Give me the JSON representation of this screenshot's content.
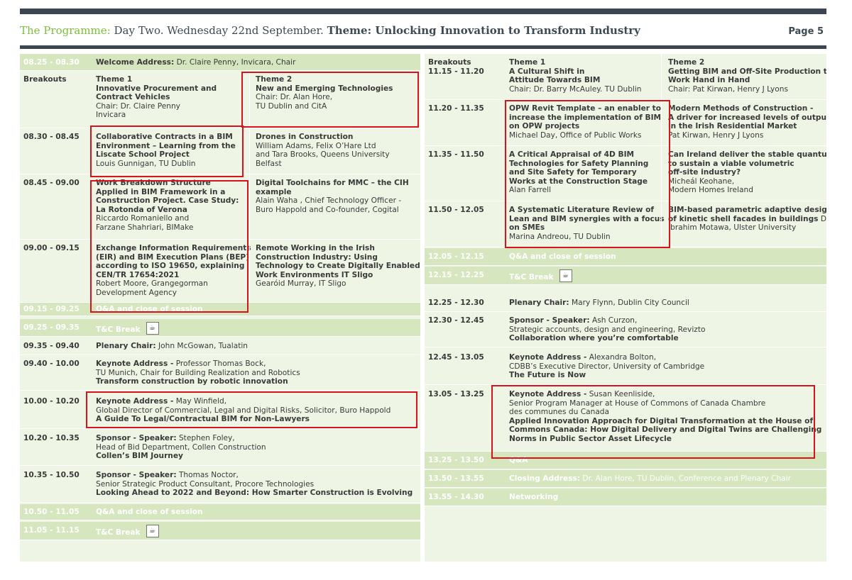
{
  "header": {
    "programme": "The Programme:",
    "day": "Day Two. Wednesday 22nd September.",
    "theme": "Theme: Unlocking Innovation to Transform Industry",
    "page": "Page 5"
  },
  "left": {
    "r1": {
      "time": "08.25 - 08.30",
      "label": "Welcome Address:",
      "text": " Dr. Claire Penny, Invicara, Chair"
    },
    "r2": {
      "time": "Breakouts",
      "a": [
        "Theme 1",
        "Innovative Procurement and",
        "Contract Vehicles",
        "Chair: Dr. Claire Penny",
        "Invicara"
      ],
      "b": [
        "Theme 2",
        "New and Emerging Technologies",
        "Chair: Dr. Alan Hore,",
        "TU Dublin and CitA"
      ]
    },
    "r3": {
      "time": "08.30 - 08.45",
      "a": [
        "Collaborative Contracts in a BIM",
        "Environment – Learning from the",
        "Liscate School Project",
        "Louis Gunnigan, TU Dublin"
      ],
      "b": [
        "Drones in Construction",
        "William Adams, Felix O’Hare Ltd",
        "and Tara Brooks, Queens University",
        "Belfast"
      ]
    },
    "r4": {
      "time": "08.45 - 09.00",
      "a": [
        "Work Breakdown Structure",
        "Applied in BIM Framework in a",
        "Construction Project. Case Study:",
        "La Rotonda of Verona",
        "Riccardo Romaniello and",
        "Farzane Shahriari, BIMake"
      ],
      "b": [
        "Digital Toolchains for MMC – the CIH",
        "example",
        "Alain Waha , Chief Technology Officer -",
        "Buro Happold and Co-founder, Cogital"
      ]
    },
    "r5": {
      "time": "09.00 - 09.15",
      "a": [
        "Exchange Information Requirements",
        "(EIR) and BIM Execution Plans (BEP)",
        "according to ISO 19650, explaining",
        "CEN/TR 17654:2021",
        "Robert Moore, Grangegorman",
        "Development Agency"
      ],
      "b": [
        "Remote Working in the Irish",
        "Construction Industry: Using",
        "Technology to Create Digitally Enabled",
        "Work Environments IT Sligo",
        "Gearóid Murray, IT Sligo"
      ]
    },
    "r6": {
      "time": "09.15 - 09.25",
      "text": "Q&A and close of session"
    },
    "r7": {
      "time": "09.25 - 09.35",
      "text": "T&C Break"
    },
    "r8": {
      "time": "09.35 - 09.40",
      "label": "Plenary Chair:",
      "text": " John McGowan, Tualatin"
    },
    "r9": {
      "time": "09.40 - 10.00",
      "label": "Keynote Address -",
      "text": " Professor Thomas Bock,",
      "l2": "TU Munich, Chair for Building Realization and Robotics",
      "l3": "Transform construction by robotic innovation"
    },
    "r10": {
      "time": "10.00 - 10.20",
      "label": "Keynote Address -",
      "text": " May Winfield,",
      "l2": "Global Director of Commercial, Legal and Digital Risks, Solicitor,  Buro Happold",
      "l3": "A Guide To Legal/Contractual BIM for Non-Lawyers"
    },
    "r11": {
      "time": "10.20 - 10.35",
      "label": "Sponsor - Speaker:",
      "text": " Stephen Foley,",
      "l2": "Head of Bid Department, Collen Construction",
      "l3": "Collen’s BIM Journey"
    },
    "r12": {
      "time": "10.35 - 10.50",
      "label": "Sponsor - Speaker:",
      "text": " Thomas Noctor,",
      "l2": "Senior Strategic Product Consultant,  Procore Technologies",
      "l3": "Looking Ahead to 2022 and Beyond: How Smarter Construction is Evolving"
    },
    "r13": {
      "time": "10.50 - 11.05",
      "text": "Q&A and close of session"
    },
    "r14": {
      "time": "11.05 - 11.15",
      "text": "T&C Break"
    }
  },
  "right": {
    "r1": {
      "time": "Breakouts",
      "time2": "11.15 - 11.20",
      "a": [
        "Theme 1",
        "A Cultural Shift in",
        "Attitude Towards BIM",
        "Chair: Dr. Barry McAuley. TU Dublin"
      ],
      "b": [
        "Theme 2",
        "Getting BIM and Off-Site Production to",
        "Work Hand in Hand",
        "Chair: Pat Kirwan, Henry J Lyons"
      ]
    },
    "r2": {
      "time": "11.20 - 11.35",
      "a": [
        "OPW Revit Template – an enabler to",
        "increase the implementation of BIM",
        "on OPW projects",
        "Michael Day, Office of Public Works"
      ],
      "b": [
        "Modern Methods of Construction -",
        "A driver for increased levels of output",
        "in the Irish Residential Market",
        "Pat Kirwan, Henry J Lyons"
      ]
    },
    "r3": {
      "time": "11.35 - 11.50",
      "a": [
        "A Critical Appraisal of 4D BIM",
        "Technologies for Safety Planning",
        "and Site Safety for Temporary",
        "Works at the Construction Stage",
        "Alan Farrell"
      ],
      "b": [
        "Can Ireland deliver the stable quantum",
        "to sustain a viable volumetric",
        "off-site industry?",
        "Micheál Keohane,",
        "Modern Homes Ireland"
      ]
    },
    "r4": {
      "time": "11.50 - 12.05",
      "a": [
        "A Systematic Literature Review of",
        "Lean and BIM synergies with a focus",
        "on SMEs",
        "Marina Andreou, TU Dublin"
      ],
      "b": [
        "BIM-based parametric adaptive design",
        "of kinetic shell facades in buildings",
        "Dr.",
        "Ibrahim Motawa, Ulster University"
      ]
    },
    "r5": {
      "time": "12.05 - 12.15",
      "text": "Q&A and close of session"
    },
    "r6": {
      "time": "12.15 - 12.25",
      "text": "T&C Break"
    },
    "r7": {
      "time": "12.25 - 12.30",
      "label": "Plenary Chair:",
      "text": " Mary Flynn, Dublin City Council"
    },
    "r8": {
      "time": "12.30 - 12.45",
      "label": "Sponsor - Speaker:",
      "text": " Ash Curzon,",
      "l2": "Strategic accounts, design and engineering, Revizto",
      "l3": "Collaboration where you’re comfortable"
    },
    "r9": {
      "time": "12.45 - 13.05",
      "label": "Keynote Address -",
      "text": " Alexandra Bolton,",
      "l2": "CDBB’s Executive Director, University of Cambridge",
      "l3": "The Future is Now"
    },
    "r10": {
      "time": "13.05 - 13.25",
      "label": "Keynote Address -",
      "text": " Susan Keenliside,",
      "l2": "Senior Program Manager at House of Commons of Canada Chambre",
      "l2b": "des communes du Canada",
      "l3": "Applied Innovation Approach for Digital Transformation at the House of",
      "l4": "Commons Canada: How Digital Delivery and Digital Twins are Challenging",
      "l5": "Norms in Public Sector Asset Lifecycle"
    },
    "r11": {
      "time": "13.25 - 13.50",
      "text": "Q&A"
    },
    "r12": {
      "time": "13.50 - 13.55",
      "label": "Closing Address:",
      "text": " Dr. Alan Hore, TU Dublin, Conference and Plenary Chair"
    },
    "r13": {
      "time": "13.55 - 14.30",
      "text": "Networking"
    }
  },
  "icons": {
    "break": "coffee-cup-icon"
  },
  "colors": {
    "accent": "#7cbf3a",
    "dark": "#3c4650",
    "row_green": "#d6e7bf",
    "bg_light": "#eff5e4",
    "highlight_box": "#d8131c"
  }
}
